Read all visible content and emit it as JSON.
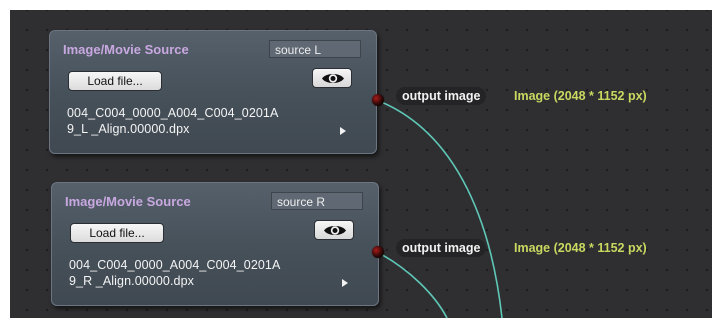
{
  "nodes": [
    {
      "title": "Image/Movie Source",
      "name": "source L",
      "load_label": "Load file...",
      "file_line1": "004_C004_0000_A004_C004_0201A",
      "file_line2": "9_L _Align.00000.dpx",
      "output_port_label": "output image",
      "output_type": "Image (2048 * 1152 px)"
    },
    {
      "title": "Image/Movie Source",
      "name": "source R",
      "load_label": "Load file...",
      "file_line1": "004_C004_0000_A004_C004_0201A",
      "file_line2": "9_R _Align.00000.dpx",
      "output_port_label": "output image",
      "output_type": "Image (2048 * 1152 px)"
    }
  ],
  "icons": {
    "preview": "eye-icon",
    "expand": "triangle-right-icon",
    "port": "output-port-icon"
  },
  "colors": {
    "canvas_bg": "#2f2f31",
    "node_title": "#c8a8e0",
    "wire": "#5fc7b7",
    "type_text": "#c9d860",
    "port": "#aa1a1a"
  }
}
